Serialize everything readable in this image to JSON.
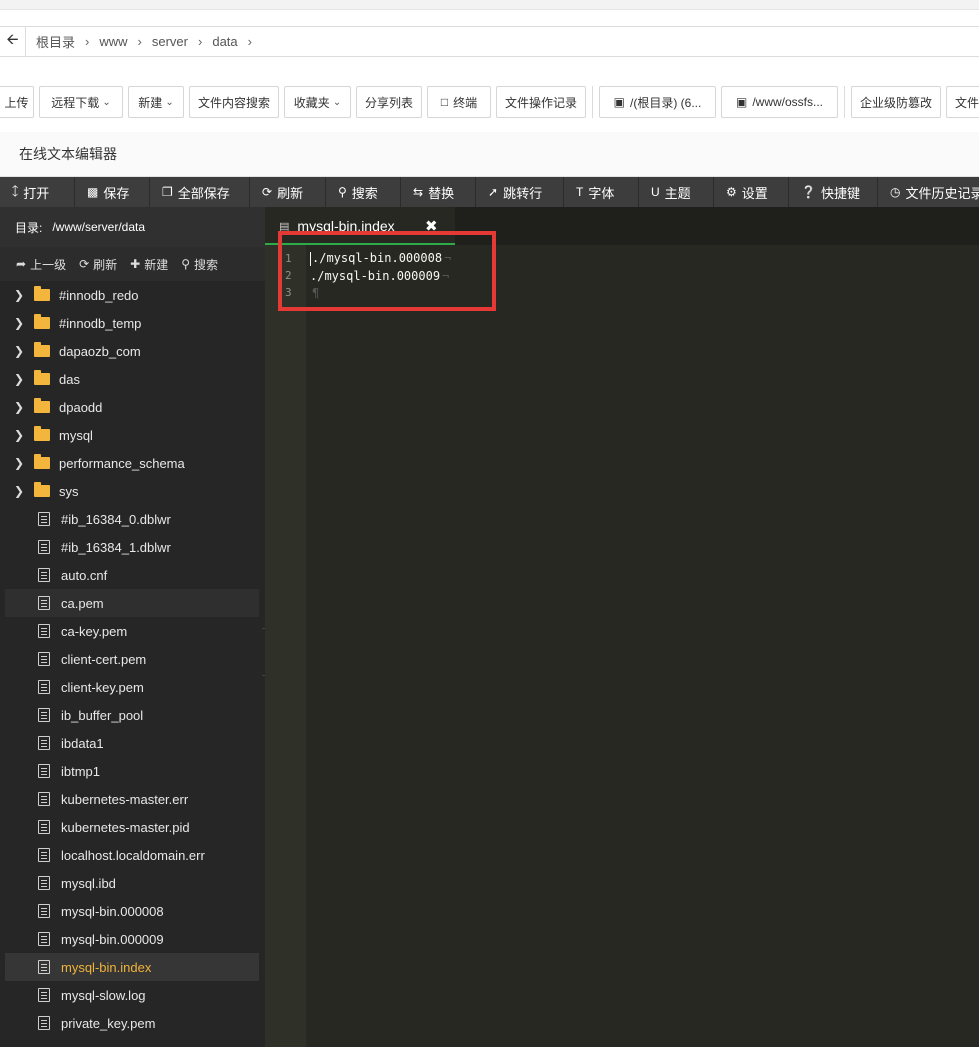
{
  "breadcrumb": {
    "items": [
      "根目录",
      "www",
      "server",
      "data"
    ]
  },
  "toolbar": {
    "upload": "上传",
    "remote_download": "远程下载",
    "new": "新建",
    "content_search": "文件内容搜索",
    "favorites": "收藏夹",
    "share_list": "分享列表",
    "terminal": "终端",
    "file_log": "文件操作记录",
    "disk_root": "/(根目录) (6...",
    "disk_oss": "/www/ossfs...",
    "tamper": "企业级防篡改",
    "more": "文件"
  },
  "editor": {
    "window_title": "在线文本编辑器",
    "menu": {
      "open": "打开",
      "save": "保存",
      "save_all": "全部保存",
      "refresh": "刷新",
      "search": "搜索",
      "replace": "替换",
      "goto": "跳转行",
      "font": "字体",
      "theme": "主题",
      "settings": "设置",
      "shortcuts": "快捷键",
      "history": "文件历史记录"
    },
    "tab_title": "mysql-bin.index",
    "lines": [
      {
        "num": "1",
        "text": "./mysql-bin.000008"
      },
      {
        "num": "2",
        "text": "./mysql-bin.000009"
      },
      {
        "num": "3",
        "text": ""
      }
    ]
  },
  "sidebar": {
    "dir_label": "目录:",
    "dir_path": "/www/server/data",
    "actions": {
      "up": "上一级",
      "refresh": "刷新",
      "new": "新建",
      "search": "搜索"
    },
    "folders": [
      "#innodb_redo",
      "#innodb_temp",
      "dapaozb_com",
      "das",
      "dpaodd",
      "mysql",
      "performance_schema",
      "sys"
    ],
    "files": [
      "#ib_16384_0.dblwr",
      "#ib_16384_1.dblwr",
      "auto.cnf",
      "ca.pem",
      "ca-key.pem",
      "client-cert.pem",
      "client-key.pem",
      "ib_buffer_pool",
      "ibdata1",
      "ibtmp1",
      "kubernetes-master.err",
      "kubernetes-master.pid",
      "localhost.localdomain.err",
      "mysql.ibd",
      "mysql-bin.000008",
      "mysql-bin.000009",
      "mysql-bin.index",
      "mysql-slow.log",
      "private_key.pem"
    ],
    "active_file": "mysql-bin.index",
    "hover_file": "ca.pem"
  },
  "colors": {
    "sidebar_bg": "#262626",
    "editor_bg": "#272822",
    "active_file": "#f0b33a",
    "folder": "#f3b53c",
    "highlight_box": "#e53935",
    "tab_underline": "#2faa48"
  }
}
